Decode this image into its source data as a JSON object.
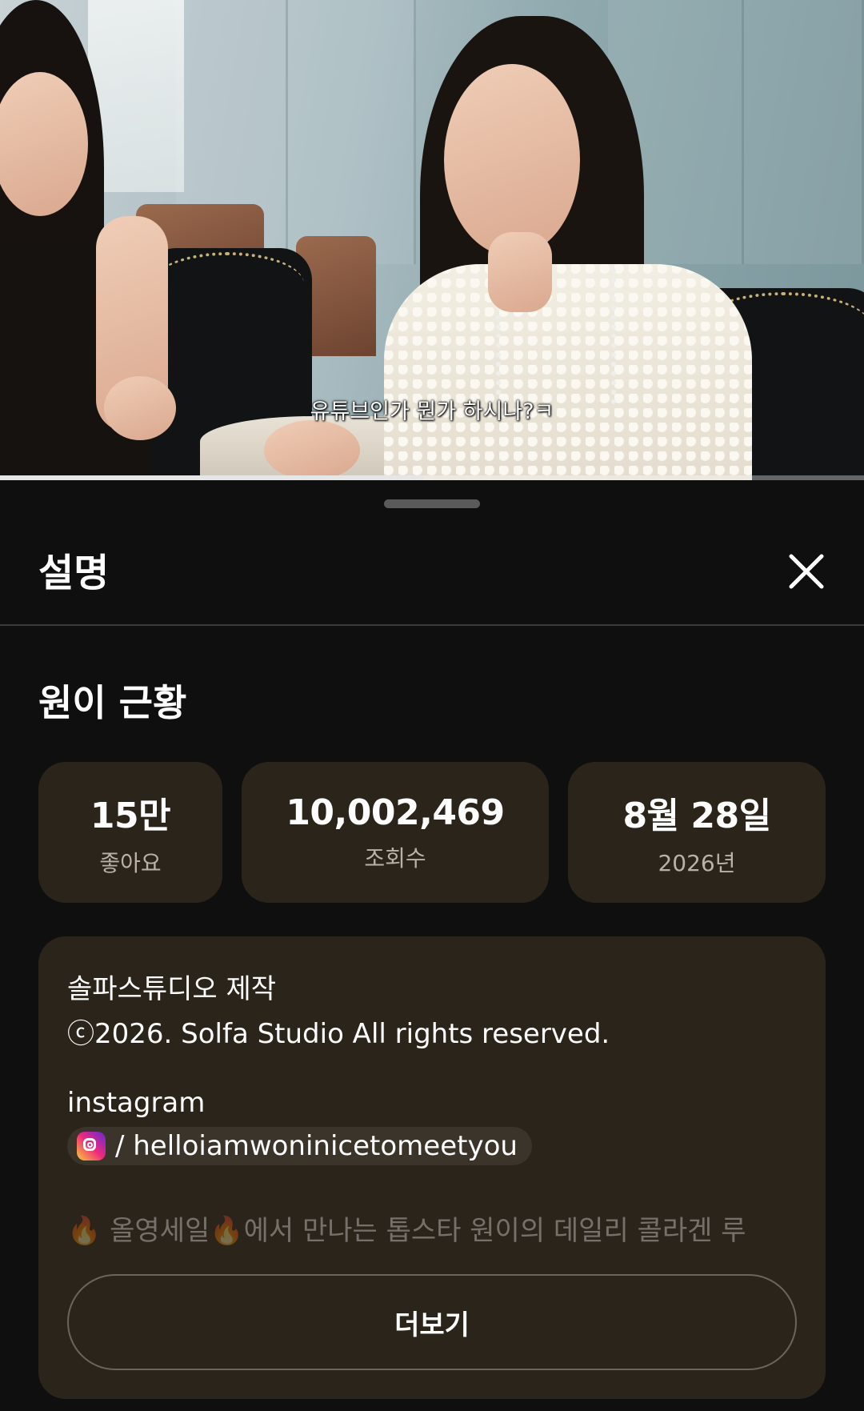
{
  "video": {
    "subtitle": "유튜브인가 뭔가 하시나?ㅋ",
    "progress_fraction": 0.49
  },
  "sheet": {
    "title": "설명",
    "close_icon": "close-icon"
  },
  "description": {
    "video_title": "원이 근황",
    "stats": [
      {
        "value": "15만",
        "label": "좋아요"
      },
      {
        "value": "10,002,469",
        "label": "조회수"
      },
      {
        "value": "8월 28일",
        "label": "2026년"
      }
    ],
    "lines": {
      "production": "솔파스튜디오 제작",
      "copyright": "ⓒ2026. Solfa Studio All rights reserved.",
      "instagram_label": "instagram",
      "instagram_handle": "/ helloiamwoninicetomeetyou",
      "faded_preview": "🔥 올영세일🔥에서 만나는 톱스타 원이의 데일리 콜라겐 루"
    },
    "more_button": "더보기"
  },
  "colors": {
    "background": "#0f0f0f",
    "card": "#2b241a",
    "divider": "#3a3a3a"
  }
}
